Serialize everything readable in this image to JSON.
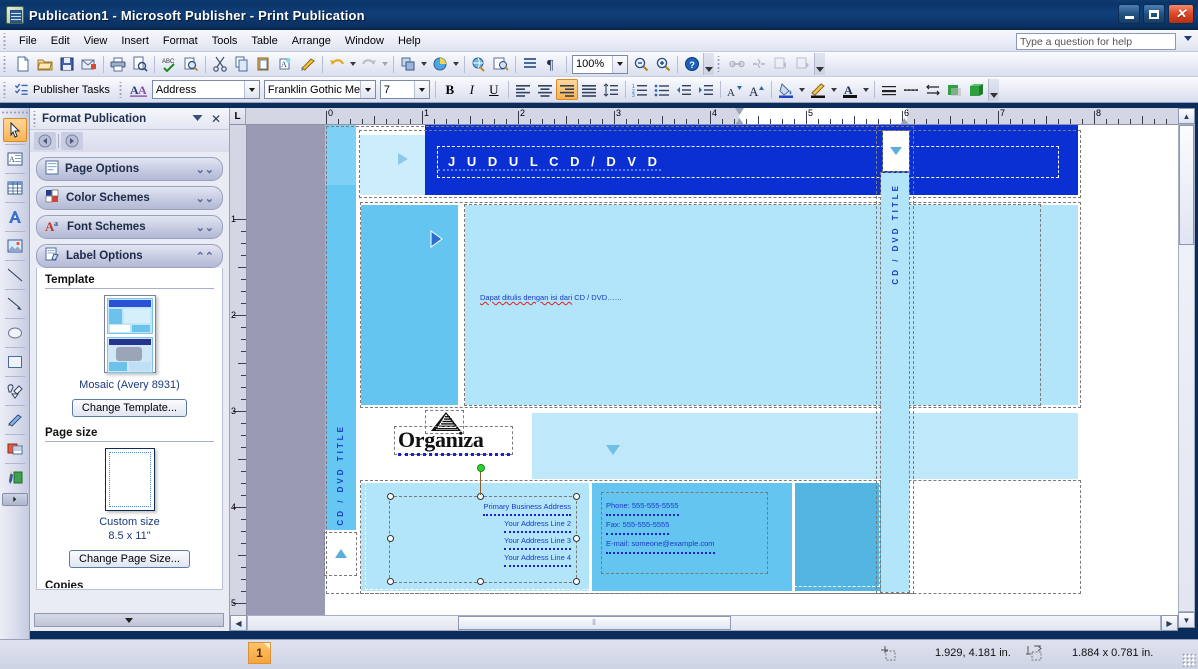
{
  "window": {
    "title": "Publication1 - Microsoft Publisher - Print Publication",
    "app_icon": "publisher-icon",
    "minimize": "_",
    "maximize": "□",
    "close": "✕"
  },
  "menubar": {
    "items": [
      "File",
      "Edit",
      "View",
      "Insert",
      "Format",
      "Tools",
      "Table",
      "Arrange",
      "Window",
      "Help"
    ],
    "ask_box_placeholder": "Type a question for help"
  },
  "standard_toolbar": {
    "buttons": [
      "new-icon",
      "open-icon",
      "save-icon",
      "email-icon",
      "print-icon",
      "print-preview-icon",
      "spelling-icon",
      "research-icon",
      "cut-icon",
      "copy-icon",
      "paste-icon",
      "format-painter-icon",
      "design-checker-icon",
      "undo-icon",
      "redo-icon",
      "arrange-icon",
      "color-wheel-icon",
      "insert-hyperlink-icon",
      "design-gallery-icon",
      "special-characters-icon",
      "show-formatting-icon"
    ],
    "zoom_value": "100%",
    "zoom_out_icon": "zoom-out-icon",
    "zoom_in_icon": "zoom-in-icon",
    "help_icon": "help-icon"
  },
  "connect_toolbar": {
    "buttons": [
      "link-textbox-icon",
      "unlink-textbox-icon",
      "previous-textbox-icon",
      "next-textbox-icon"
    ]
  },
  "formatting_toolbar": {
    "publisher_tasks_label": "Publisher Tasks",
    "styles_icon": "styles-and-formatting-icon",
    "style_value": "Address",
    "font_value": "Franklin Gothic Medi",
    "size_value": "7",
    "bold": "B",
    "italic": "I",
    "underline": "U",
    "align_left_icon": "align-left-icon",
    "align_center_icon": "align-center-icon",
    "align_right_icon": "align-right-icon",
    "align_justify_icon": "align-justify-icon",
    "line_spacing_icon": "line-spacing-icon",
    "numbering_icon": "numbering-icon",
    "bullets_icon": "bullets-icon",
    "decrease_indent_icon": "decrease-indent-icon",
    "increase_indent_icon": "increase-indent-icon",
    "decrease_font_icon": "decrease-font-size-icon",
    "increase_font_icon": "increase-font-size-icon",
    "fill_color_icon": "fill-color-icon",
    "line_color_icon": "line-color-icon",
    "font_color_icon": "font-color-icon",
    "line_style_icon": "line-style-icon",
    "dash_style_icon": "dash-style-icon",
    "arrow_style_icon": "arrow-style-icon",
    "shadow_style_icon": "shadow-style-icon",
    "3d_style_icon": "three-d-style-icon"
  },
  "objects_toolbar": {
    "tools": [
      {
        "name": "select-objects-tool",
        "icon": "arrow-pointer-icon",
        "selected": true
      },
      {
        "name": "text-box-tool",
        "icon": "text-box-icon",
        "selected": false
      },
      {
        "name": "insert-table-tool",
        "icon": "table-icon",
        "selected": false
      },
      {
        "name": "word-art-tool",
        "icon": "wordart-icon",
        "selected": false
      },
      {
        "name": "picture-frame-tool",
        "icon": "picture-frame-icon",
        "selected": false
      },
      {
        "name": "line-tool",
        "icon": "line-icon",
        "selected": false
      },
      {
        "name": "arrow-tool",
        "icon": "arrow-line-icon",
        "selected": false
      },
      {
        "name": "oval-tool",
        "icon": "oval-icon",
        "selected": false
      },
      {
        "name": "rectangle-tool",
        "icon": "rectangle-icon",
        "selected": false
      },
      {
        "name": "autoshapes-tool",
        "icon": "autoshapes-icon",
        "selected": false
      },
      {
        "name": "design-gallery-tool",
        "icon": "design-gallery-object-icon",
        "selected": false
      },
      {
        "name": "item-from-content-library-tool",
        "icon": "content-library-icon",
        "selected": false
      },
      {
        "name": "insert-design-tool",
        "icon": "insert-design-icon",
        "selected": false
      }
    ],
    "more_buttons_label": "⏵"
  },
  "task_pane": {
    "title": "Format Publication",
    "dropdown_icon": "chevron-down-icon",
    "close_icon": "close-icon",
    "back_icon": "back-arrow-icon",
    "forward_icon": "forward-arrow-icon",
    "sections": [
      {
        "label": "Page Options",
        "icon": "page-options-icon",
        "expanded": false
      },
      {
        "label": "Color Schemes",
        "icon": "color-schemes-icon",
        "expanded": false
      },
      {
        "label": "Font Schemes",
        "icon": "font-schemes-icon",
        "expanded": false
      },
      {
        "label": "Label Options",
        "icon": "label-options-icon",
        "expanded": true
      }
    ],
    "label_options": {
      "template_heading": "Template",
      "template_name": "Mosaic (Avery 8931)",
      "template_thumb_icon": "template-thumbnail",
      "change_template_button": "Change Template...",
      "page_size_heading": "Page size",
      "page_size_thumb_icon": "page-size-thumbnail",
      "page_size_name": "Custom size",
      "page_size_dims": "8.5 x 11\"",
      "change_page_size_button": "Change Page Size..."
    },
    "scroll_down_icon": "chevron-down-icon"
  },
  "rulers": {
    "corner_label": "L",
    "horizontal_ticks": [
      "0",
      "1",
      "1",
      "4",
      "5",
      "6",
      "7",
      "8"
    ],
    "vertical_ticks": [
      "1",
      "2",
      "3",
      "4",
      "5"
    ]
  },
  "document": {
    "title_banner": "J U D U L     C D     /     D V D",
    "body_text": "Dapat ditulis dengan isi dari CD / DVD……",
    "spine_left": "CD / DVD TITLE",
    "spine_right": "CD / DVD TITLE",
    "logo_text": "Organiza",
    "logo_icon": "mountain-logo-icon",
    "address": [
      "Primary Business Address",
      "Your Address Line 2",
      "Your Address Line 3",
      "Your Address Line 4"
    ],
    "contact": [
      "Phone: 555-555-5555",
      "Fax: 555-555-5555",
      "E-mail: someone@example.com"
    ],
    "colors": {
      "banner_blue": "#0a2fd2",
      "panel_light": "#a9dffa",
      "panel_mid": "#63c6f0",
      "panel_dark": "#4cb3e0",
      "text_blue": "#1b39c9"
    }
  },
  "status_bar": {
    "page_number": "1",
    "position_icon": "position-icon",
    "position_value": "1.929, 4.181 in.",
    "size_icon": "object-size-icon",
    "size_value": "1.884 x  0.781 in."
  }
}
